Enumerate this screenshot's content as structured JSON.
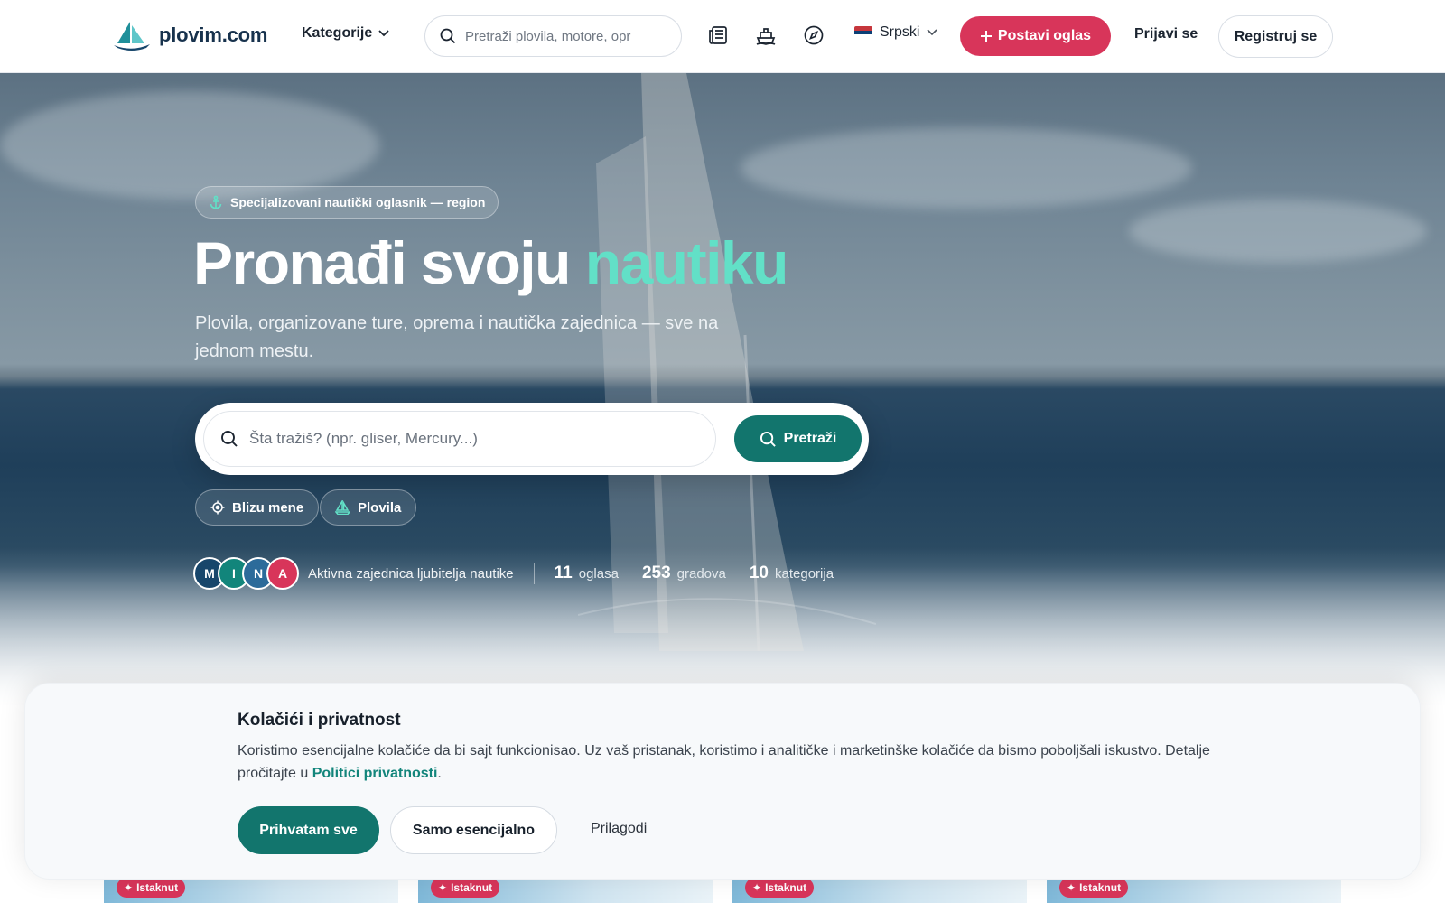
{
  "header": {
    "logo_text": "plovim.com",
    "categories_label": "Kategorije",
    "search_placeholder": "Pretraži plovila, motore, opr",
    "language_label": "Srpski",
    "post_ad_label": "Postavi oglas",
    "login_label": "Prijavi se",
    "register_label": "Registruj se",
    "icons": [
      "news-icon",
      "boat-icon",
      "compass-icon"
    ]
  },
  "hero": {
    "badge": "Specijalizovani nautički oglasnik — region",
    "title_main": "Pronađi svoju ",
    "title_accent": "nautiku",
    "subtitle": "Plovila, organizovane ture, oprema i nautička zajednica — sve na jednom mestu.",
    "search_placeholder": "Šta tražiš? (npr. gliser, Mercury...)",
    "search_button": "Pretraži",
    "chips": [
      {
        "label": "Blizu mene",
        "icon": "location-icon"
      },
      {
        "label": "Plovila",
        "icon": "sailboat-icon"
      }
    ],
    "avatars": [
      {
        "letter": "M",
        "color": "#17466b"
      },
      {
        "letter": "I",
        "color": "#12857b"
      },
      {
        "letter": "N",
        "color": "#2c6b9a"
      },
      {
        "letter": "A",
        "color": "#d8355a"
      }
    ],
    "community_text": "Aktivna zajednica ljubitelja nautike",
    "stats": [
      {
        "value": "11",
        "label": "oglasa"
      },
      {
        "value": "253",
        "label": "gradova"
      },
      {
        "value": "10",
        "label": "kategorija"
      }
    ]
  },
  "cookie": {
    "title": "Kolačići i privatnost",
    "text_before": "Koristimo esencijalne kolačiće da bi sajt funkcionisao. Uz vaš pristanak, koristimo i analitičke i marketinške kolačiće da bismo poboljšali iskustvo. Detalje pročitajte u ",
    "link_text": "Politici privatnosti",
    "text_after": ".",
    "accept_all": "Prihvatam sve",
    "essential_only": "Samo esencijalno",
    "customize": "Prilagodi"
  },
  "cards": [
    {
      "tag": "Istaknut"
    },
    {
      "tag": "Istaknut"
    },
    {
      "tag": "Istaknut"
    },
    {
      "tag": "Istaknut"
    }
  ],
  "colors": {
    "brand_red": "#d8355a",
    "brand_teal": "#12756d",
    "accent_mint": "#62e0c7",
    "logo_navy": "#17324d"
  }
}
